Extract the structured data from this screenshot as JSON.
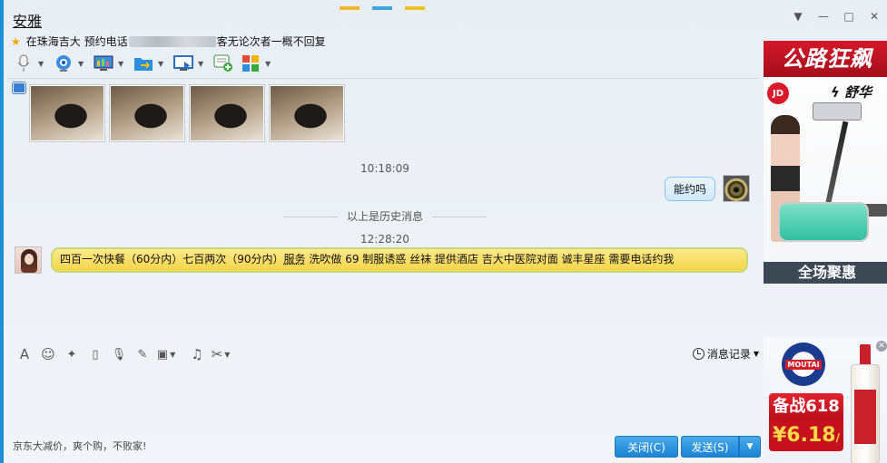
{
  "window": {
    "title": "安雅",
    "signature_prefix": "在珠海吉大 预约电话",
    "signature_suffix": "客无论次者一概不回复"
  },
  "chat": {
    "timestamp_1": "10:18:09",
    "my_message": "能约吗",
    "history_divider": "以上是历史消息",
    "timestamp_2": "12:28:20",
    "her_message_before_link": "四百一次快餐（60分内）七百两次（90分内）",
    "her_message_link": "服务",
    "her_message_after_link": " 洗吹做 69 制服诱惑 丝袜 提供酒店 吉大中医院对面 诚丰星座 需要电话约我"
  },
  "input_toolbar": {
    "history_label": "消息记录"
  },
  "footer": {
    "promo_text": "京东大减价，爽个购，不败家!",
    "close_label": "关闭(C)",
    "send_label": "发送(S)"
  },
  "ads": {
    "ad1_header": "公路狂飙",
    "ad1_jd": "JD",
    "ad1_brand": "舒华",
    "ad1_footer": "全场聚惠",
    "ad2_badge": "备战618",
    "ad2_price": "¥6.18",
    "ad2_price_unit": "/瓶",
    "ad2_moutai": "MOUTAI"
  },
  "colors": {
    "accent_blue": "#1d8fd6",
    "her_bubble": "#f4d549",
    "my_bubble": "#cfe8fb",
    "ad_red": "#d4182a"
  },
  "icons": [
    "microphone-icon",
    "webcam-icon",
    "screen-share-icon",
    "file-transfer-icon",
    "remote-desktop-icon",
    "chat-add-icon",
    "apps-icon",
    "font-icon",
    "emoji-icon",
    "magic-icon",
    "vibrate-icon",
    "mic-icon",
    "edit-icon",
    "image-icon",
    "music-icon",
    "scissors-icon",
    "clock-icon"
  ]
}
